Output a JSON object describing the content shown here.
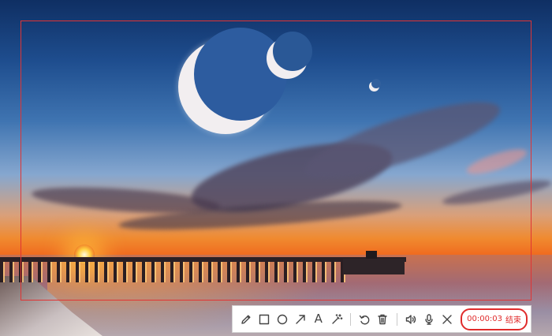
{
  "toolbar": {
    "tools": [
      {
        "name": "pencil-icon",
        "label": "pencil"
      },
      {
        "name": "rectangle-icon",
        "label": "rectangle"
      },
      {
        "name": "circle-icon",
        "label": "circle"
      },
      {
        "name": "arrow-icon",
        "label": "arrow"
      },
      {
        "name": "text-icon",
        "label": "A"
      },
      {
        "name": "magic-wand-icon",
        "label": "highlighter"
      }
    ],
    "edit_tools": [
      {
        "name": "undo-icon"
      },
      {
        "name": "trash-icon"
      }
    ],
    "media_tools": [
      {
        "name": "speaker-icon"
      },
      {
        "name": "microphone-icon"
      },
      {
        "name": "close-icon"
      }
    ],
    "text_tool_glyph": "A",
    "timer": {
      "time": "00:00:03",
      "end_label": "结束"
    }
  },
  "colors": {
    "accent_red": "#e02b2b",
    "frame_red": "#e03434",
    "toolbar_bg": "#ffffff",
    "icon_color": "#444444"
  }
}
